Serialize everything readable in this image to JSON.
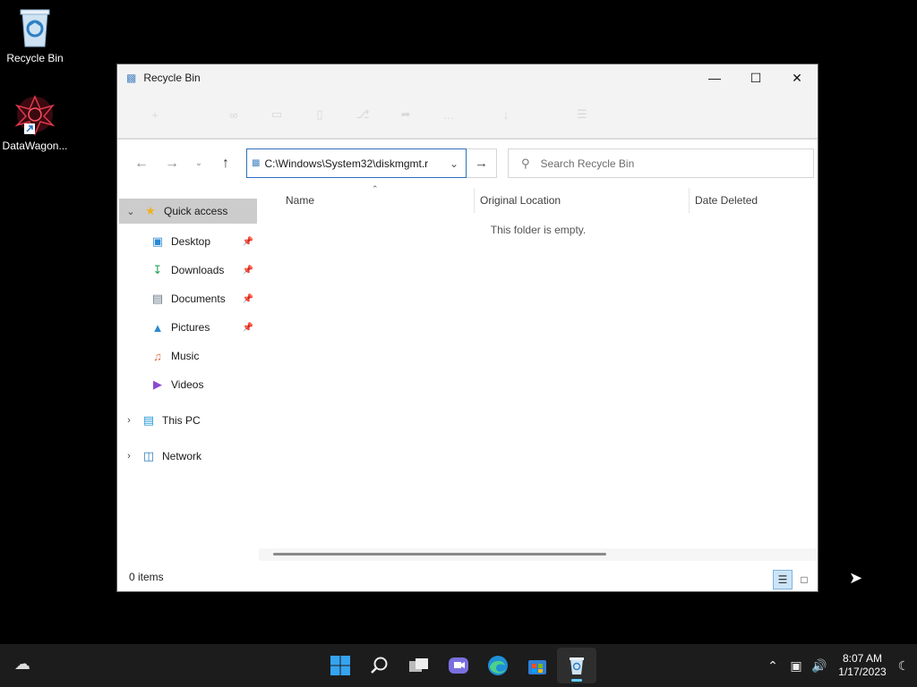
{
  "desktop": {
    "icons": [
      {
        "label": "Recycle Bin"
      },
      {
        "label": "DataWagon..."
      }
    ]
  },
  "window": {
    "title": "Recycle Bin",
    "nav": {
      "address": "C:\\Windows\\System32\\diskmgmt.r",
      "search_placeholder": "Search Recycle Bin"
    },
    "sidebar": {
      "quick_access": "Quick access",
      "items": [
        {
          "label": "Desktop"
        },
        {
          "label": "Downloads"
        },
        {
          "label": "Documents"
        },
        {
          "label": "Pictures"
        },
        {
          "label": "Music"
        },
        {
          "label": "Videos"
        }
      ],
      "this_pc": "This PC",
      "network": "Network"
    },
    "columns": [
      "Name",
      "Original Location",
      "Date Deleted"
    ],
    "empty_message": "This folder is empty.",
    "status": "0 items"
  },
  "taskbar": {
    "time": "8:07 AM",
    "date": "1/17/2023"
  },
  "colors": {
    "accent": "#0078d4",
    "taskbar": "#1c1c1c",
    "selection": "#cccccc"
  }
}
